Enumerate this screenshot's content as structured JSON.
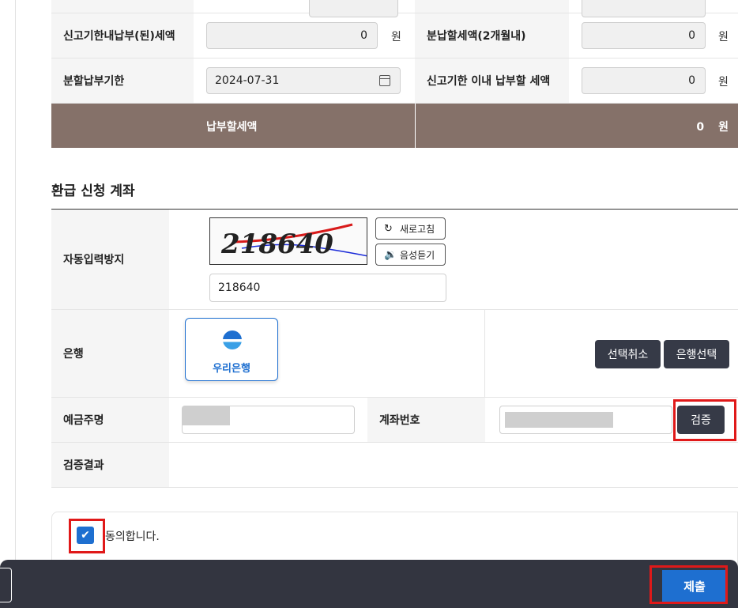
{
  "tax_table": {
    "row1": {
      "label_left": "신고기한내납부(된)세액",
      "value_left": "0",
      "unit_left": "원",
      "label_right": "분납할세액(2개월내)",
      "value_right": "0",
      "unit_right": "원"
    },
    "row2": {
      "label_left": "분할납부기한",
      "date_value": "2024-07-31",
      "label_right": "신고기한 이내 납부할 세액",
      "value_right": "0",
      "unit_right": "원"
    },
    "total": {
      "label": "납부할세액",
      "value": "0",
      "unit": "원"
    }
  },
  "refund_section": {
    "title": "환급 신청 계좌",
    "captcha": {
      "label": "자동입력방지",
      "image_text": "218640",
      "refresh_label": "새로고침",
      "audio_label": "음성듣기",
      "input_value": "218640"
    },
    "bank": {
      "label": "은행",
      "selected_bank": "우리은행",
      "cancel_label": "선택취소",
      "select_label": "은행선택"
    },
    "account": {
      "holder_label": "예금주명",
      "number_label": "계좌번호",
      "verify_label": "검증"
    },
    "result": {
      "label": "검증결과"
    }
  },
  "agreement": {
    "checked": true,
    "text": "동의합니다."
  },
  "footer": {
    "submit_label": "제출"
  },
  "colors": {
    "total_bar": "#857169",
    "primary": "#1e6fd0",
    "dark_button": "#363a47",
    "highlight": "#e01919"
  }
}
